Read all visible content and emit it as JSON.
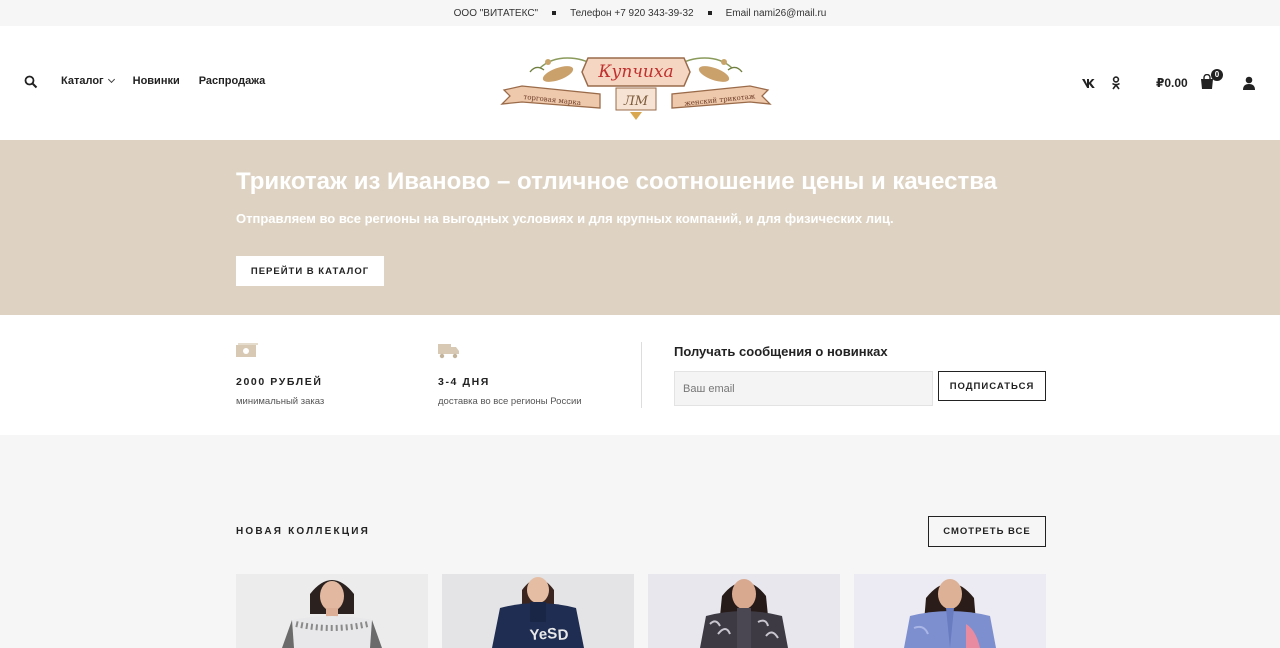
{
  "topbar": {
    "company": "ООО \"ВИТАТЕКС\"",
    "phone": "Телефон +7 920 343-39-32",
    "email": "Email  nami26@mail.ru"
  },
  "nav": {
    "items": [
      {
        "label": "Каталог"
      },
      {
        "label": "Новинки"
      },
      {
        "label": "Распродажа"
      }
    ]
  },
  "logo": {
    "text": "Купчиха",
    "left_ribbon": "торговая марка",
    "right_ribbon": "женский трикотаж",
    "monogram": "ЛМ"
  },
  "social": {
    "vk": "vk",
    "ok": "ok"
  },
  "cart": {
    "total": "₽0.00",
    "count": "0"
  },
  "hero": {
    "title": "Трикотаж из Иваново – отличное соотношение цены и качества",
    "subtitle": "Отправляем во все регионы на выгодных условиях и для крупных компаний, и для физических лиц.",
    "button": "ПЕРЕЙТИ В КАТАЛОГ"
  },
  "features": [
    {
      "icon": "money-icon",
      "title": "2000 РУБЛЕЙ",
      "desc": "минимальный заказ"
    },
    {
      "icon": "truck-icon",
      "title": "3-4 ДНЯ",
      "desc": "доставка во все регионы России"
    }
  ],
  "subscribe": {
    "title": "Получать сообщения о новинках",
    "placeholder": "Ваш email",
    "button": "ПОДПИСАТЬСЯ"
  },
  "collection": {
    "title": "НОВАЯ КОЛЛЕКЦИЯ",
    "see_all": "СМОТРЕТЬ ВСЕ",
    "products": [
      {
        "name": "product-1"
      },
      {
        "name": "product-2"
      },
      {
        "name": "product-3"
      },
      {
        "name": "product-4"
      }
    ]
  },
  "colors": {
    "hero_bg": "#ded3c3",
    "page_bg": "#f6f6f6",
    "accent_icon": "#d7c9b4"
  }
}
